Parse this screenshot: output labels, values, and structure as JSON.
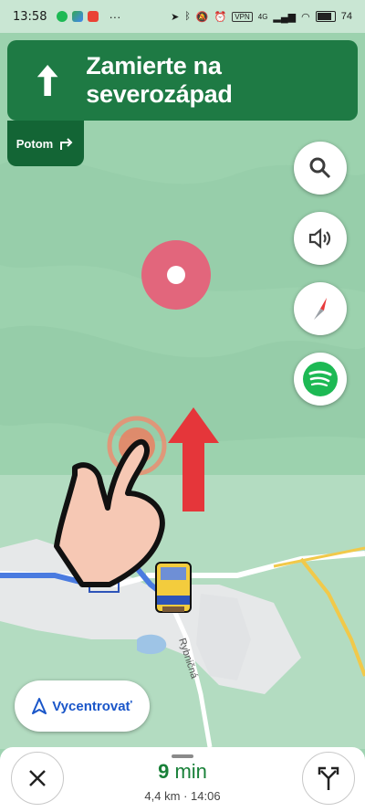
{
  "status_bar": {
    "time": "13:58",
    "more": "···",
    "vpn": "VPN",
    "network": "4G",
    "battery": "74"
  },
  "navigation": {
    "instruction": "Zamierte na severozápad",
    "then_label": "Potom"
  },
  "map": {
    "street_label": "Rybničná"
  },
  "recenter_label": "Vycentrovať",
  "trip": {
    "duration_value": "9",
    "duration_unit": "min",
    "distance": "4,4 km",
    "dot": "·",
    "arrival_time": "14:06"
  },
  "colors": {
    "banner_green": "#1e7a44",
    "then_green": "#136535",
    "eta_green": "#188038",
    "recenter_blue": "#1a56c9",
    "route_blue": "#4a7be0"
  },
  "icons": [
    "up-arrow-icon",
    "turn-right-icon",
    "search-icon",
    "volume-icon",
    "compass-icon",
    "spotify-icon",
    "navigation-arrow-icon",
    "close-icon",
    "alternate-routes-icon"
  ]
}
